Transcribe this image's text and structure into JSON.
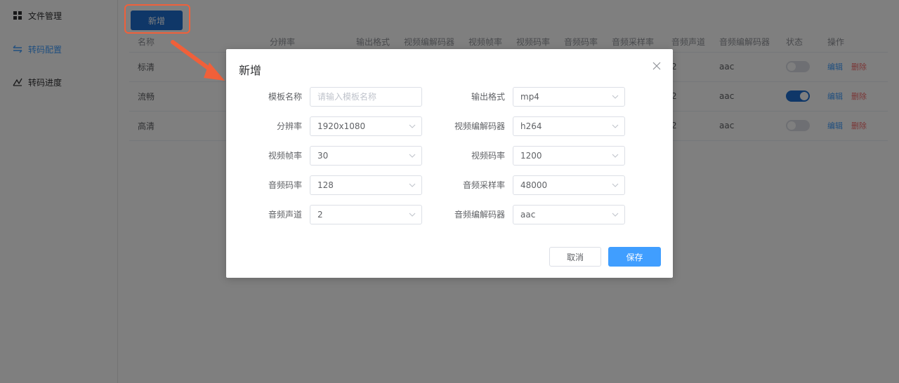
{
  "sidebar": {
    "items": [
      {
        "label": "文件管理",
        "icon": "grid-icon",
        "active": false
      },
      {
        "label": "转码配置",
        "icon": "swap-icon",
        "active": true
      },
      {
        "label": "转码进度",
        "icon": "progress-icon",
        "active": false
      }
    ]
  },
  "toolbar": {
    "add_label": "新增"
  },
  "table": {
    "columns": [
      "名称",
      "分辨率",
      "输出格式",
      "视频编解码器",
      "视频帧率",
      "视频码率",
      "音频码率",
      "音频采样率",
      "音频声道",
      "音频编解码器",
      "状态",
      "操作"
    ],
    "rows": [
      {
        "name": "标清",
        "channels": "2",
        "acodec": "aac",
        "enabled": false
      },
      {
        "name": "流畅",
        "channels": "2",
        "acodec": "aac",
        "enabled": true
      },
      {
        "name": "高清",
        "channels": "2",
        "acodec": "aac",
        "enabled": false
      }
    ],
    "edit_label": "编辑",
    "delete_label": "删除"
  },
  "dialog": {
    "title": "新增",
    "fields": {
      "template_name": {
        "label": "模板名称",
        "placeholder": "请输入模板名称",
        "value": ""
      },
      "output_format": {
        "label": "输出格式",
        "value": "mp4"
      },
      "resolution": {
        "label": "分辨率",
        "value": "1920x1080"
      },
      "video_codec": {
        "label": "视频编解码器",
        "value": "h264"
      },
      "video_fps": {
        "label": "视频帧率",
        "value": "30"
      },
      "video_bitrate": {
        "label": "视频码率",
        "value": "1200"
      },
      "audio_bitrate": {
        "label": "音频码率",
        "value": "128"
      },
      "audio_samplerate": {
        "label": "音频采样率",
        "value": "48000"
      },
      "audio_channels": {
        "label": "音频声道",
        "value": "2"
      },
      "audio_codec": {
        "label": "音频编解码器",
        "value": "aac"
      }
    },
    "cancel_label": "取消",
    "save_label": "保存"
  },
  "colors": {
    "primary": "#409eff",
    "primary_dark": "#1e6fd0",
    "danger": "#f56c6c",
    "annotation": "#f0603a"
  }
}
